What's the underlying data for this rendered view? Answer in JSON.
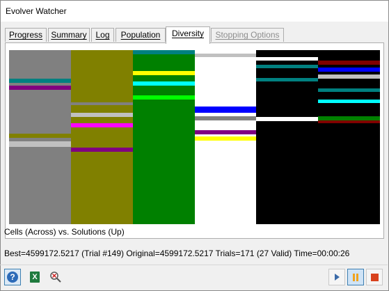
{
  "window": {
    "title": "Evolver Watcher"
  },
  "tabs": [
    {
      "label": "Progress",
      "active": false,
      "disabled": false
    },
    {
      "label": "Summary",
      "active": false,
      "disabled": false
    },
    {
      "label": "Log",
      "active": false,
      "disabled": false
    },
    {
      "label": "Population",
      "active": false,
      "disabled": false
    },
    {
      "label": "Diversity",
      "active": true,
      "disabled": false
    },
    {
      "label": "Stopping Options",
      "active": false,
      "disabled": true
    }
  ],
  "diversity": {
    "caption": "Cells (Across) vs. Solutions (Up)",
    "columns": [
      {
        "color": "#808080",
        "stripes": [
          {
            "y": 0.165,
            "h": 0.022,
            "color": "#008080"
          },
          {
            "y": 0.205,
            "h": 0.022,
            "color": "#800080"
          },
          {
            "y": 0.48,
            "h": 0.022,
            "color": "#808000"
          },
          {
            "y": 0.525,
            "h": 0.03,
            "color": "#c0c0c0"
          }
        ]
      },
      {
        "color": "#808000",
        "stripes": [
          {
            "y": 0.3,
            "h": 0.016,
            "color": "#808080"
          },
          {
            "y": 0.36,
            "h": 0.022,
            "color": "#c0c0c0"
          },
          {
            "y": 0.42,
            "h": 0.022,
            "color": "#ff00ff"
          },
          {
            "y": 0.56,
            "h": 0.022,
            "color": "#800080"
          }
        ]
      },
      {
        "color": "#008000",
        "stripes": [
          {
            "y": 0.0,
            "h": 0.022,
            "color": "#008080"
          },
          {
            "y": 0.12,
            "h": 0.022,
            "color": "#ffff00"
          },
          {
            "y": 0.18,
            "h": 0.022,
            "color": "#00ffff"
          },
          {
            "y": 0.26,
            "h": 0.022,
            "color": "#00ff00"
          }
        ]
      },
      {
        "color": "#ffffff",
        "stripes": [
          {
            "y": 0.02,
            "h": 0.018,
            "color": "#c0c0c0"
          },
          {
            "y": 0.325,
            "h": 0.035,
            "color": "#0000ff"
          },
          {
            "y": 0.38,
            "h": 0.022,
            "color": "#808080"
          },
          {
            "y": 0.46,
            "h": 0.022,
            "color": "#800080"
          },
          {
            "y": 0.495,
            "h": 0.022,
            "color": "#ffff00"
          }
        ]
      },
      {
        "color": "#000000",
        "stripes": [
          {
            "y": 0.04,
            "h": 0.018,
            "color": "#ffffff"
          },
          {
            "y": 0.085,
            "h": 0.02,
            "color": "#008080"
          },
          {
            "y": 0.16,
            "h": 0.02,
            "color": "#008080"
          },
          {
            "y": 0.385,
            "h": 0.022,
            "color": "#ffffff"
          }
        ]
      },
      {
        "color": "#000000",
        "stripes": [
          {
            "y": 0.06,
            "h": 0.022,
            "color": "#800000"
          },
          {
            "y": 0.1,
            "h": 0.022,
            "color": "#0000ff"
          },
          {
            "y": 0.14,
            "h": 0.022,
            "color": "#c0c0c0"
          },
          {
            "y": 0.22,
            "h": 0.02,
            "color": "#008080"
          },
          {
            "y": 0.285,
            "h": 0.02,
            "color": "#00ffff"
          },
          {
            "y": 0.38,
            "h": 0.022,
            "color": "#008000"
          },
          {
            "y": 0.405,
            "h": 0.016,
            "color": "#800000"
          }
        ]
      }
    ]
  },
  "status": {
    "text": "Best=4599172.5217 (Trial #149) Original=4599172.5217 Trials=171 (27 Valid) Time=00:00:26"
  },
  "toolbar": {
    "help_icon": "help-icon",
    "help_glyph": "?",
    "excel_icon": "excel-icon",
    "excel_glyph": "X",
    "find_icon": "magnify-x-icon",
    "play_icon": "play-icon",
    "pause_icon": "pause-icon",
    "stop_icon": "stop-icon"
  }
}
